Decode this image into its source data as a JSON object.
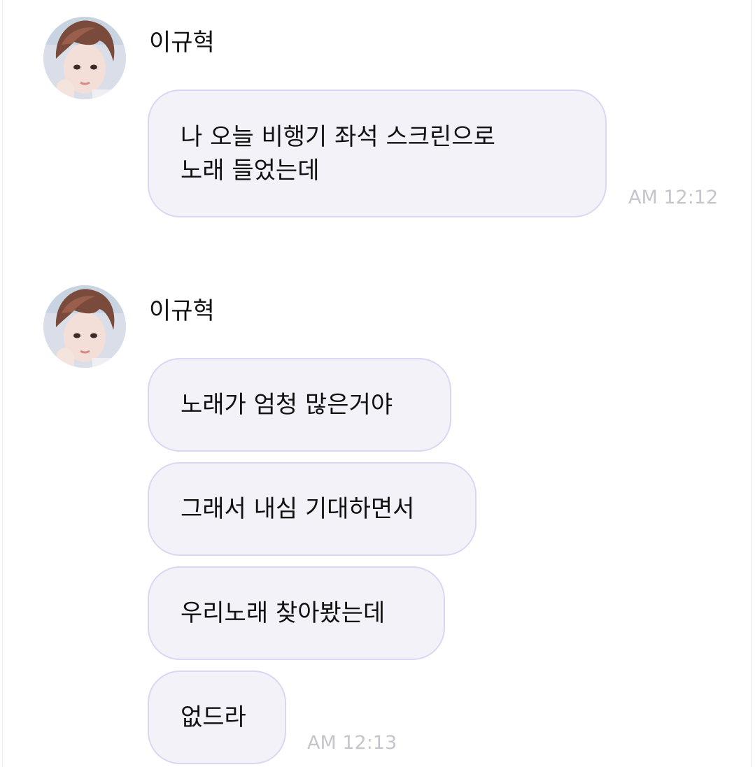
{
  "messages": [
    {
      "sender": "이규혁",
      "avatar_icon": "profile-photo",
      "bubbles": [
        [
          "나 오늘 비행기 좌석 스크린으로",
          "노래 들었는데"
        ]
      ],
      "time": "AM 12:12"
    },
    {
      "sender": "이규혁",
      "avatar_icon": "profile-photo",
      "bubbles": [
        [
          "노래가 엄청 많은거야"
        ],
        [
          "그래서 내심 기대하면서"
        ],
        [
          "우리노래 찾아봤는데"
        ],
        [
          "없드라"
        ]
      ],
      "time": "AM 12:13"
    }
  ],
  "colors": {
    "bubble_bg": "#f3f2f9",
    "bubble_border": "#dcd6f4",
    "timestamp": "#c5c5cc"
  }
}
